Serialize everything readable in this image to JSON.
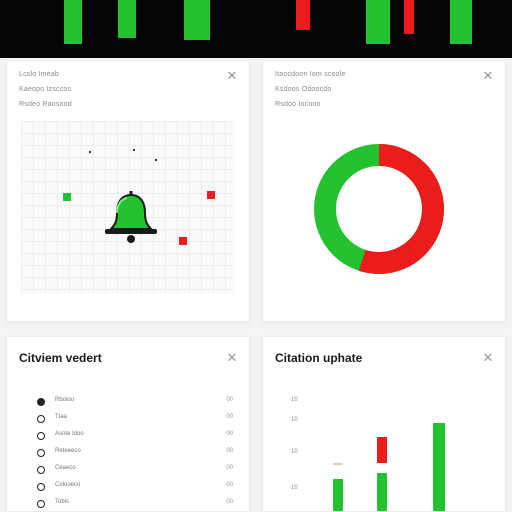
{
  "colors": {
    "green": "#22c32e",
    "red": "#ec1c1c",
    "dark": "#050505"
  },
  "candles": [
    {
      "color": "green"
    },
    {
      "color": "green"
    },
    {
      "color": "green"
    },
    {
      "color": "red"
    },
    {
      "color": "green"
    },
    {
      "color": "red"
    },
    {
      "color": "green"
    }
  ],
  "card1": {
    "meta": [
      "Lcslo Imeab",
      "Kaeopo Izsccos",
      "Rsdeo Raosood"
    ],
    "icon": "bell-icon"
  },
  "card2": {
    "meta": [
      "Itaocdoon Iom scoole",
      "Ksdoos Odoocdo",
      "Rsdoo Iocnoo"
    ],
    "donut": {
      "red_fraction": 0.55,
      "green_fraction": 0.45
    }
  },
  "card3": {
    "title": "Citviem vedert",
    "items": [
      {
        "label": "Rboioo",
        "value": "00",
        "selected": true
      },
      {
        "label": "Ttaa",
        "value": "00",
        "selected": false
      },
      {
        "label": "Asote Idoo",
        "value": "00",
        "selected": false
      },
      {
        "label": "Reteeeco",
        "value": "00",
        "selected": false
      },
      {
        "label": "Ceaeco",
        "value": "00",
        "selected": false
      },
      {
        "label": "Colooeco",
        "value": "00",
        "selected": false
      },
      {
        "label": "Tobis",
        "value": "00",
        "selected": false
      }
    ]
  },
  "card4": {
    "title": "Citation uphate",
    "yticks": [
      "10",
      "10",
      "10",
      "10"
    ]
  }
}
